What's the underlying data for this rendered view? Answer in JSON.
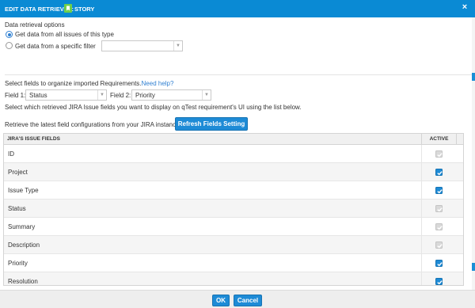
{
  "dialog": {
    "title": "EDIT DATA RETRIEVAL:",
    "type_label": "STORY",
    "type_icon": "bookmark-icon",
    "close_glyph": "×"
  },
  "retrieval": {
    "heading": "Data retrieval options",
    "option_all": "Get data from all issues of this type",
    "option_filter": "Get data from a specific filter",
    "filter_value": ""
  },
  "organize": {
    "text": "Select fields to organize imported Requirements.",
    "help_link": "Need help?",
    "field1_label": "Field 1:",
    "field1_value": "Status",
    "field2_label": "Field 2:",
    "field2_value": "Priority",
    "display_text": "Select which retrieved JIRA Issue fields you want to display on qTest requirement's UI using the list below.",
    "refresh_text": "Retrieve the latest field configurations from your JIRA instance",
    "refresh_button": "Refresh Fields Setting"
  },
  "table": {
    "col_fields": "JIRA'S ISSUE FIELDS",
    "col_active": "ACTIVE",
    "rows": [
      {
        "name": "ID",
        "state": "disabled"
      },
      {
        "name": "Project",
        "state": "checked"
      },
      {
        "name": "Issue Type",
        "state": "checked"
      },
      {
        "name": "Status",
        "state": "disabled"
      },
      {
        "name": "Summary",
        "state": "disabled"
      },
      {
        "name": "Description",
        "state": "disabled"
      },
      {
        "name": "Priority",
        "state": "checked"
      },
      {
        "name": "Resolution",
        "state": "checked"
      }
    ]
  },
  "footer": {
    "ok": "OK",
    "cancel": "Cancel"
  },
  "colors": {
    "header_bg": "#0a8ad4",
    "primary_button": "#1e8bd6",
    "link": "#2f7fd1",
    "story_icon": "#6fcf4b"
  }
}
